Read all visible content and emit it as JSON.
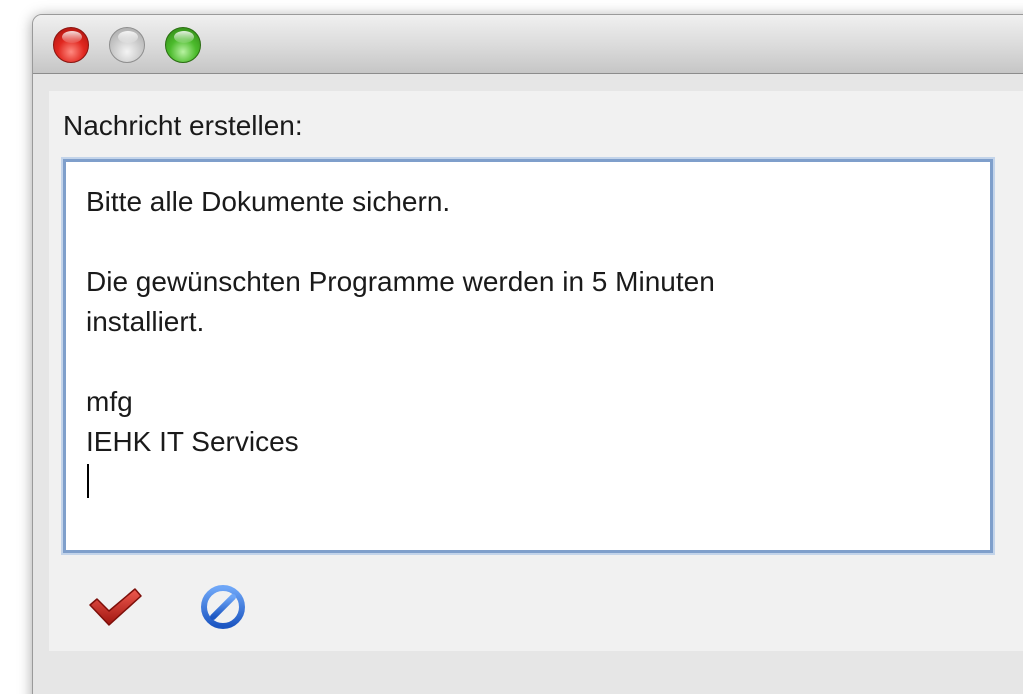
{
  "window": {
    "title": "",
    "controls": {
      "close": "close-window",
      "minimize": "minimize-window",
      "zoom": "zoom-window"
    }
  },
  "dialog": {
    "label": "Nachricht erstellen:",
    "message": "Bitte alle Dokumente sichern.\n\nDie gewünschten Programme werden in 5 Minuten\ninstalliert.\n\nmfg\nIEHK IT Services\n",
    "buttons": {
      "ok_icon": "checkmark-icon",
      "cancel_icon": "prohibit-icon"
    }
  },
  "colors": {
    "ok": "#c0281e",
    "cancel": "#2f6fd6",
    "focus_ring": "#7f9fcb"
  }
}
